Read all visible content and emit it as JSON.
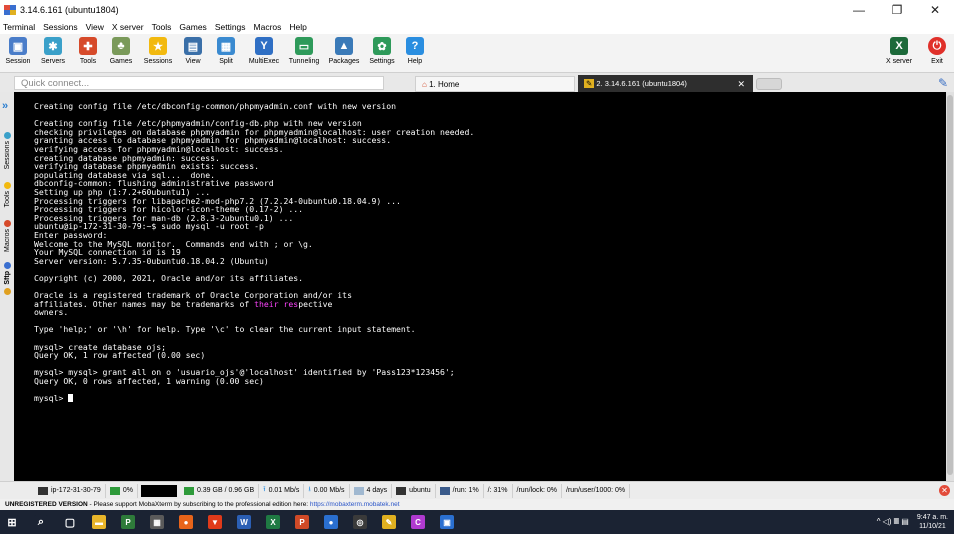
{
  "window": {
    "title": "3.14.6.161 (ubuntu1804)",
    "controls": [
      "—",
      "❐",
      "✕"
    ]
  },
  "menu": [
    "Terminal",
    "Sessions",
    "View",
    "X server",
    "Tools",
    "Games",
    "Settings",
    "Macros",
    "Help"
  ],
  "toolbar": {
    "items": [
      {
        "label": "Session",
        "icon": "session-icon",
        "color": "#4a7dc9",
        "glyph": "▣"
      },
      {
        "label": "Servers",
        "icon": "servers-icon",
        "color": "#3aa0c9",
        "glyph": "✱"
      },
      {
        "label": "Tools",
        "icon": "tools-icon",
        "color": "#d64a2a",
        "glyph": "✚"
      },
      {
        "label": "Games",
        "icon": "games-icon",
        "color": "#7a9a5a",
        "glyph": "♣"
      },
      {
        "label": "Sessions",
        "icon": "star-icon",
        "color": "#f2b90f",
        "glyph": "★"
      },
      {
        "label": "View",
        "icon": "view-icon",
        "color": "#3a6fa8",
        "glyph": "▤"
      },
      {
        "label": "Split",
        "icon": "split-icon",
        "color": "#3a8ad0",
        "glyph": "▦"
      },
      {
        "label": "MultiExec",
        "icon": "multiexec-icon",
        "color": "#2f6fc4",
        "glyph": "Y"
      },
      {
        "label": "Tunneling",
        "icon": "tunneling-icon",
        "color": "#2e9a5a",
        "glyph": "▭"
      },
      {
        "label": "Packages",
        "icon": "packages-icon",
        "color": "#3a7ab8",
        "glyph": "▲"
      },
      {
        "label": "Settings",
        "icon": "settings-icon",
        "color": "#2e9a5a",
        "glyph": "✿"
      },
      {
        "label": "Help",
        "icon": "help-icon",
        "color": "#2a8ee0",
        "glyph": "?"
      }
    ],
    "right": [
      {
        "label": "X server",
        "icon": "xserver-icon",
        "color": "#1d6a3a",
        "glyph": "X"
      },
      {
        "label": "Exit",
        "icon": "exit-icon",
        "color": "#e0302a",
        "glyph": "⏻"
      }
    ]
  },
  "tabs": {
    "quick_connect_placeholder": "Quick connect...",
    "home": "1. Home",
    "active": "2. 3.14.6.161 (ubuntu1804)",
    "close": "✕"
  },
  "sidebar": [
    "Sessions",
    "Tools",
    "Macros",
    "Sftp"
  ],
  "terminal": {
    "lines": [
      "Creating config file /etc/dbconfig-common/phpmyadmin.conf with new version",
      "",
      "Creating config file /etc/phpmyadmin/config-db.php with new version",
      "checking privileges on database phpmyadmin for phpmyadmin@localhost: user creation needed.",
      "granting access to database phpmyadmin for phpmyadmin@localhost: success.",
      "verifying access for phpmyadmin@localhost: success.",
      "creating database phpmyadmin: success.",
      "verifying database phpmyadmin exists: success.",
      "populating database via sql...  done.",
      "dbconfig-common: flushing administrative password",
      "Setting up php (1:7.2+60ubuntu1) ...",
      "Processing triggers for libapache2-mod-php7.2 (7.2.24-0ubuntu0.18.04.9) ...",
      "Processing triggers for hicolor-icon-theme (0.17-2) ...",
      "Processing triggers for man-db (2.8.3-2ubuntu0.1) ...",
      "ubuntu@ip-172-31-30-79:~$ sudo mysql -u root -p",
      "Enter password:",
      "Welcome to the MySQL monitor.  Commands end with ; or \\g.",
      "Your MySQL connection id is 19",
      "Server version: 5.7.35-0ubuntu0.18.04.2 (Ubuntu)",
      "",
      "Copyright (c) 2000, 2021, Oracle and/or its affiliates.",
      "",
      "Oracle is a registered trademark of Oracle Corporation and/or its",
      "affiliates. Other names may be trademarks of |their| |res|pective",
      "owners.",
      "",
      "Type 'help;' or '\\h' for help. Type '\\c' to clear the current input statement.",
      "",
      "mysql> create database ojs;",
      "Query OK, 1 row affected (0.00 sec)",
      "",
      "mysql> mysql> grant all on o 'usuario_ojs'@'localhost' identified by 'Pass123*123456';",
      "Query OK, 0 rows affected, 1 warning (0.00 sec)",
      "",
      "mysql> "
    ]
  },
  "status": {
    "host": "ip-172-31-30-79",
    "cpu": "0%",
    "memory": "0.39 GB / 0.96 GB",
    "upload": "0.01 Mb/s",
    "download": "0.00 Mb/s",
    "uptime": "4 days",
    "user": "ubuntu",
    "disks": [
      "/run: 1%",
      "/: 31%",
      "/run/lock: 0%",
      "/run/user/1000: 0%"
    ]
  },
  "unregistered": {
    "bold": "UNREGISTERED VERSION",
    "text": " -  Please support MobaXterm by subscribing to the professional edition here: ",
    "link": "https://mobaxterm.mobatek.net"
  },
  "taskbar": {
    "apps": [
      {
        "icon": "windows-start-icon",
        "glyph": "⊞",
        "color": "#1b2333"
      },
      {
        "icon": "search-icon",
        "glyph": "⌕",
        "color": "#1b2333"
      },
      {
        "icon": "task-view-icon",
        "glyph": "▢",
        "color": "#1b2333"
      },
      {
        "icon": "file-explorer-icon",
        "glyph": "▬",
        "color": "#e8b52a"
      },
      {
        "icon": "project-icon",
        "glyph": "P",
        "color": "#2e7b3a"
      },
      {
        "icon": "calculator-icon",
        "glyph": "▦",
        "color": "#5a5a5a"
      },
      {
        "icon": "firefox-icon",
        "glyph": "●",
        "color": "#e8641a"
      },
      {
        "icon": "brave-icon",
        "glyph": "▼",
        "color": "#e03a1a"
      },
      {
        "icon": "word-icon",
        "glyph": "W",
        "color": "#2b5fb4"
      },
      {
        "icon": "excel-icon",
        "glyph": "X",
        "color": "#1f7a43"
      },
      {
        "icon": "powerpoint-icon",
        "glyph": "P",
        "color": "#d14a27"
      },
      {
        "icon": "chat-icon",
        "glyph": "●",
        "color": "#2a6fd0"
      },
      {
        "icon": "chrome-icon",
        "glyph": "◎",
        "color": "#3a3a3a"
      },
      {
        "icon": "mobaxterm-icon",
        "glyph": "✎",
        "color": "#e0b020"
      },
      {
        "icon": "app-c-icon",
        "glyph": "C",
        "color": "#b03ad0"
      },
      {
        "icon": "remote-icon",
        "glyph": "▣",
        "color": "#2a6fd0"
      }
    ],
    "tray": "^ ◁) 𝄜 ▤",
    "time": "9:47 a. m.",
    "date": "11/10/21"
  }
}
